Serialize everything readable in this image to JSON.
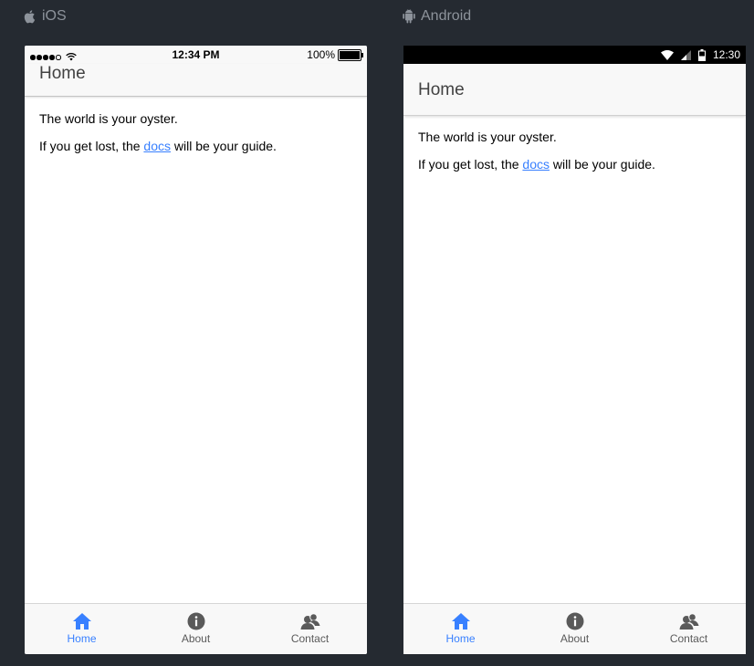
{
  "platforms": {
    "ios_label": "iOS",
    "android_label": "Android"
  },
  "ios": {
    "status_time": "12:34 PM",
    "battery_text": "100%",
    "battery_level": 1.0,
    "header_title": "Home"
  },
  "android": {
    "status_time": "12:30",
    "header_title": "Home"
  },
  "content": {
    "line1": "The world is your oyster.",
    "line2_before": "If you get lost, the ",
    "link_text": "docs",
    "line2_after": " will be your guide."
  },
  "tabs": [
    {
      "label": "Home",
      "icon": "home-icon",
      "active": true
    },
    {
      "label": "About",
      "icon": "info-icon",
      "active": false
    },
    {
      "label": "Contact",
      "icon": "contacts-icon",
      "active": false
    }
  ],
  "colors": {
    "accent": "#3880ff",
    "background": "#252a31",
    "toolbar": "#f8f8f8",
    "inactive_tab": "#5a5a5a"
  }
}
